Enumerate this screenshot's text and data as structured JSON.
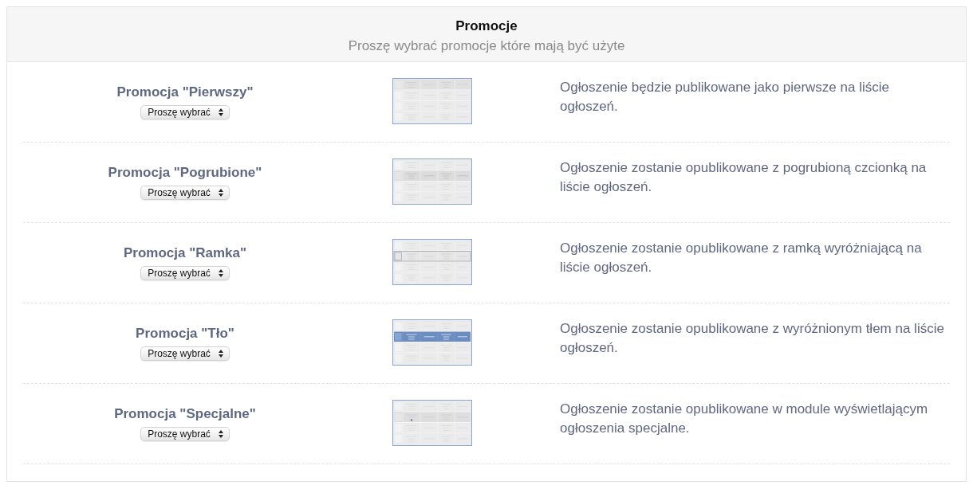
{
  "header": {
    "title": "Promocje",
    "subtitle": "Proszę wybrać promocje które mają być użyte"
  },
  "promotions": [
    {
      "title": "Promocja \"Pierwszy\"",
      "select": {
        "value": "Proszę wybrać"
      },
      "preview": {
        "kind": "first"
      },
      "description": "Ogłoszenie będzie publikowane jako pierwsze na liście ogłoszeń."
    },
    {
      "title": "Promocja \"Pogrubione\"",
      "select": {
        "value": "Proszę wybrać"
      },
      "preview": {
        "kind": "bold"
      },
      "description": "Ogłoszenie zostanie opublikowane z pogrubioną czcionką na liście ogłoszeń."
    },
    {
      "title": "Promocja \"Ramka\"",
      "select": {
        "value": "Proszę wybrać"
      },
      "preview": {
        "kind": "frame"
      },
      "description": "Ogłoszenie zostanie opublikowane z ramką wyróżniającą na liście ogłoszeń."
    },
    {
      "title": "Promocja \"Tło\"",
      "select": {
        "value": "Proszę wybrać"
      },
      "preview": {
        "kind": "background"
      },
      "description": "Ogłoszenie zostanie opublikowane z wyróżnionym tłem na liście ogłoszeń."
    },
    {
      "title": "Promocja \"Specjalne\"",
      "select": {
        "value": "Proszę wybrać"
      },
      "preview": {
        "kind": "special"
      },
      "description": "Ogłoszenie zostanie opublikowane w module wyświetlającym ogłoszenia specjalne."
    }
  ]
}
